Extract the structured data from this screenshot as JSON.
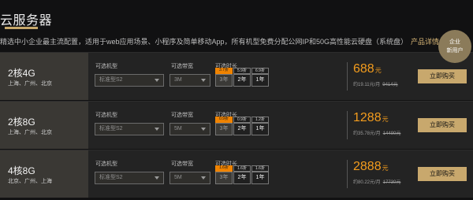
{
  "header": {
    "title": "云服务器",
    "subtitle": "精选中小企业最主流配置，适用于web应用场景、小程序及简单移动App，所有机型免费分配公网IP和50G高性能云硬盘（系统盘）",
    "more_link": "产品详情 >"
  },
  "corner_badge": {
    "line1": "企业",
    "line2": "新用户"
  },
  "labels": {
    "model": "可选机型",
    "bandwidth": "可选带宽",
    "duration": "可选时长"
  },
  "rows": [
    {
      "spec": "2核4G",
      "region": "上海、广州、北京",
      "model": "标准型S2",
      "bandwidth": "3M",
      "durations": [
        {
          "label": "3年",
          "badge": "3.7折"
        },
        {
          "label": "2年",
          "badge": "5.9折"
        },
        {
          "label": "1年",
          "badge": "6.9折"
        }
      ],
      "price": "688",
      "unit": "元",
      "per_month": "约19.11元/月",
      "original": "9414元",
      "buy": "立即购买"
    },
    {
      "spec": "2核8G",
      "region": "上海、广州、北京",
      "model": "标准型S2",
      "bandwidth": "5M",
      "durations": [
        {
          "label": "3年",
          "badge": "0.9折"
        },
        {
          "label": "2年",
          "badge": "0.9折"
        },
        {
          "label": "1年",
          "badge": "1.2折"
        }
      ],
      "price": "1288",
      "unit": "元",
      "per_month": "约35.78元/月",
      "original": "14490元",
      "buy": "立即购买"
    },
    {
      "spec": "4核8G",
      "region": "北京、广州、上海",
      "model": "标准型S2",
      "bandwidth": "5M",
      "durations": [
        {
          "label": "3年",
          "badge": "1.6折"
        },
        {
          "label": "2年",
          "badge": "1.6折"
        },
        {
          "label": "1年",
          "badge": "1.6折"
        }
      ],
      "price": "2888",
      "unit": "元",
      "per_month": "约80.22元/月",
      "original": "17730元",
      "buy": "立即购买"
    }
  ],
  "colors": {
    "accent": "#c8a86d",
    "price": "#f39c1d",
    "badge_active": "#f08300"
  }
}
